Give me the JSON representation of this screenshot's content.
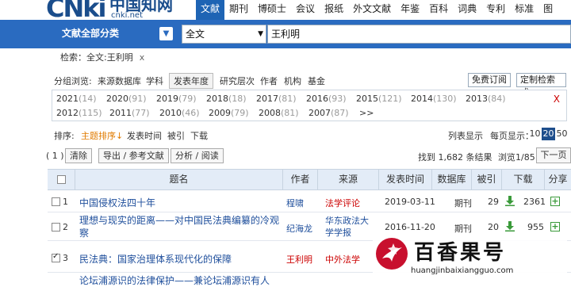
{
  "logo": {
    "brand": "CNki",
    "cjk": "中国知网",
    "url": "cnki.net"
  },
  "nav": {
    "tabs": [
      "文献",
      "期刊",
      "博硕士",
      "会议",
      "报纸",
      "外文文献",
      "年鉴",
      "百科",
      "词典",
      "专利",
      "标准",
      "图"
    ],
    "active": 0
  },
  "search": {
    "scope": "文献全部分类",
    "field": "全文",
    "query": "王利明"
  },
  "crumb": {
    "label": "检索：",
    "item": "全文:王利明",
    "close": "x"
  },
  "filter": {
    "label": "分组浏览:",
    "options": [
      "来源数据库",
      "学科",
      "发表年度",
      "研究层次",
      "作者",
      "机构",
      "基金"
    ],
    "selected": "发表年度",
    "subscribe": "免费订阅",
    "custom": "定制检索式"
  },
  "years": {
    "row1": [
      [
        "2021",
        "(14)"
      ],
      [
        "2020",
        "(91)"
      ],
      [
        "2019",
        "(79)"
      ],
      [
        "2018",
        "(18)"
      ],
      [
        "2017",
        "(81)"
      ],
      [
        "2016",
        "(93)"
      ],
      [
        "2015",
        "(121)"
      ],
      [
        "2014",
        "(130)"
      ],
      [
        "2013",
        "(84)"
      ]
    ],
    "row2": [
      [
        "2012",
        "(115)"
      ],
      [
        "2011",
        "(77)"
      ],
      [
        "2010",
        "(46)"
      ],
      [
        "2009",
        "(79)"
      ],
      [
        "2008",
        "(81)"
      ],
      [
        "2007",
        "(87)"
      ],
      [
        ">>",
        ""
      ]
    ],
    "close": "X"
  },
  "sort": {
    "label": "排序:",
    "options": [
      "主题排序",
      "发表时间",
      "被引",
      "下载"
    ],
    "active": "主题排序"
  },
  "display": {
    "list": "列表显示",
    "perpage_label": "每页显示：",
    "sizes": [
      "10",
      "20",
      "50"
    ],
    "active": "20"
  },
  "actions": {
    "selected": "( 1 )",
    "clear": "清除",
    "export": "导出 / 参考文献",
    "analyze": "分析 / 阅读",
    "found": "找到 1,682 条结果",
    "page": "浏览1/85",
    "next": "下一页"
  },
  "table": {
    "headers": [
      "",
      "题名",
      "作者",
      "来源",
      "发表时间",
      "数据库",
      "被引",
      "下载",
      "分享"
    ],
    "rows": [
      {
        "idx": "1",
        "checked": false,
        "title": "中国侵权法四十年",
        "author": "程啸",
        "author_red": false,
        "source": "法学评论",
        "source_red": true,
        "date": "2019-03-11",
        "db": "期刊",
        "cited": "29",
        "downloads": "2361"
      },
      {
        "idx": "2",
        "checked": false,
        "title": "理想与现实的距离——对中国民法典编纂的冷观察",
        "author": "纪海龙",
        "author_red": false,
        "source": "华东政法大学学报",
        "source_red": false,
        "date": "2016-11-20",
        "db": "期刊",
        "cited": "20",
        "downloads": "955"
      },
      {
        "idx": "3",
        "checked": true,
        "title": "民法典：国家治理体系现代化的保障",
        "author": "王利明",
        "author_red": true,
        "source": "中外法学",
        "source_red": true,
        "date": "",
        "db": "",
        "cited": "",
        "downloads": ""
      },
      {
        "idx": "",
        "checked": false,
        "title": "论坛浦源识的法律保护——兼论坛浦源识有人",
        "author": "",
        "author_red": false,
        "source": "",
        "source_red": false,
        "date": "",
        "db": "",
        "cited": "",
        "downloads": ""
      }
    ]
  },
  "watermark": {
    "brand": "百香果号",
    "site": "huangjinbaixiangguo.com"
  },
  "colors": {
    "blue": "#2a6bc0",
    "link": "#1f4f9c",
    "red": "#c00",
    "orange": "#e07b00",
    "green": "#3a9a3a"
  }
}
